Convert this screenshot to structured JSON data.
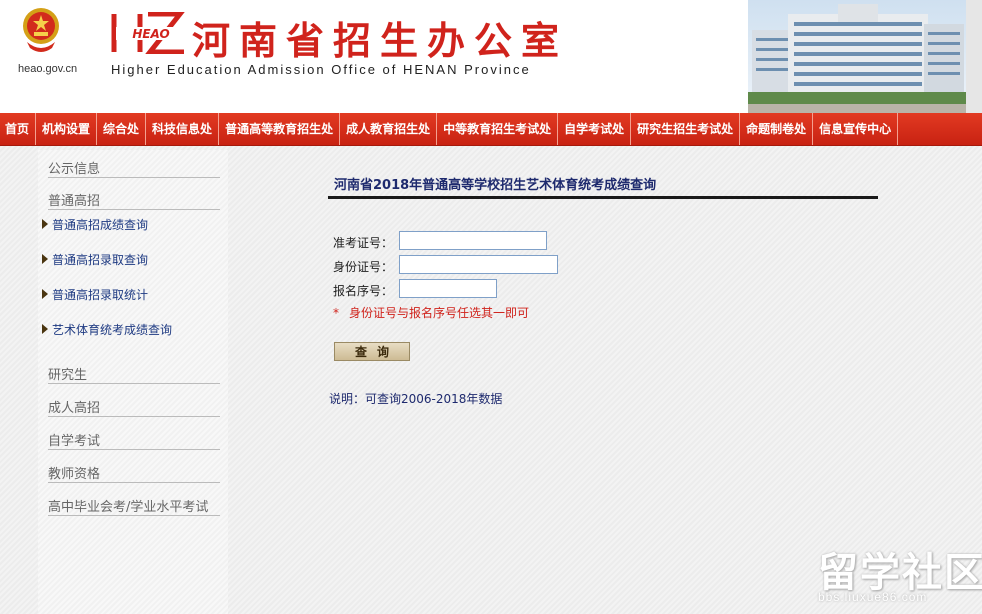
{
  "header": {
    "domain_text": "heao.gov.cn",
    "logo_text": "HEAO",
    "cn_title": "河南省招生办公室",
    "en_title": "Higher Education Admission Office of HENAN Province"
  },
  "nav": {
    "items": [
      "首页",
      "机构设置",
      "综合处",
      "科技信息处",
      "普通高等教育招生处",
      "成人教育招生处",
      "中等教育招生考试处",
      "自学考试处",
      "研究生招生考试处",
      "命题制卷处",
      "信息宣传中心"
    ]
  },
  "sidebar": {
    "headings": [
      "公示信息",
      "普通高招",
      "研究生",
      "成人高招",
      "自学考试",
      "教师资格",
      "高中毕业会考/学业水平考试"
    ],
    "links": [
      "普通高招成绩查询",
      "普通高招录取查询",
      "普通高招录取统计",
      "艺术体育统考成绩查询"
    ]
  },
  "main": {
    "title": "河南省2018年普通高等学校招生艺术体育统考成绩查询",
    "fields": [
      {
        "label": "准考证号：",
        "value": ""
      },
      {
        "label": "身份证号：",
        "value": ""
      },
      {
        "label": "报名序号：",
        "value": ""
      }
    ],
    "hint_star": "*",
    "hint": "身份证号与报名序号任选其一即可",
    "query_button": "查询",
    "note": "说明：可查询2006-2018年数据"
  },
  "watermark": {
    "big": "留学社区",
    "small": "bbs.liuxue86.com"
  },
  "colors": {
    "nav_red": "#d0271a",
    "title_red": "#d0231c",
    "link_blue": "#1e3a82"
  }
}
